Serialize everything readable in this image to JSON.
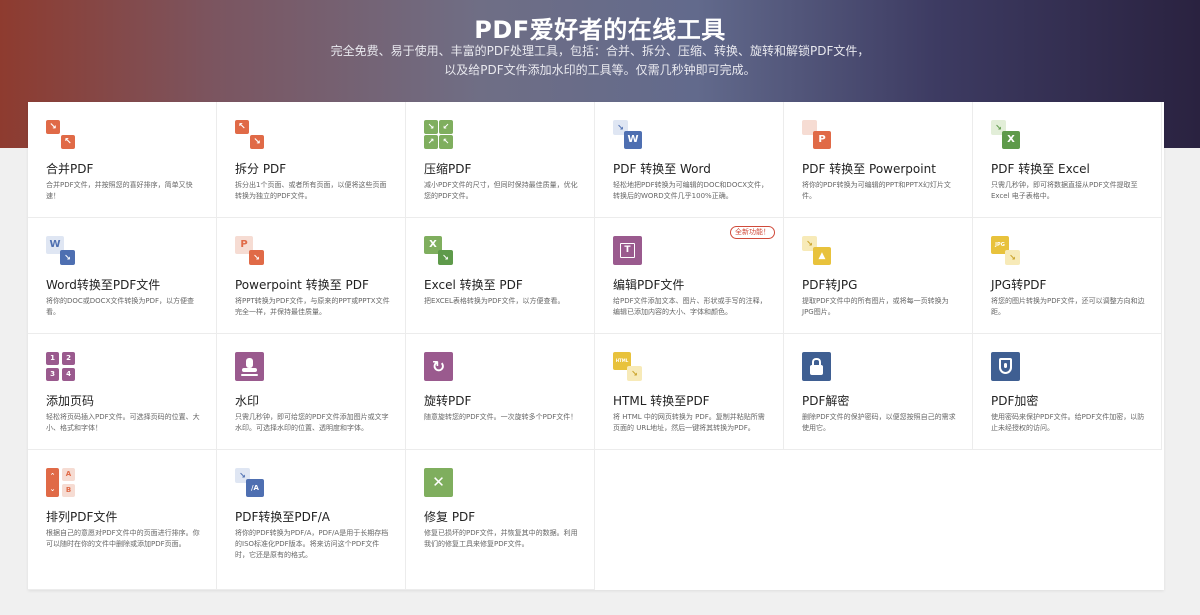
{
  "hero": {
    "title": "PDF爱好者的在线工具",
    "subtitle": "完全免费、易于使用、丰富的PDF处理工具，包括：合并、拆分、压缩、转换、旋转和解锁PDF文件，以及给PDF文件添加水印的工具等。仅需几秒钟即可完成。"
  },
  "colors": {
    "orange": "#e06a47",
    "green": "#7fae5e",
    "blue": "#4e6fb1",
    "purple": "#9a5a8e",
    "yellow": "#e8c23c",
    "navy": "#3f5f92"
  },
  "tools": [
    {
      "title": "合并PDF",
      "desc": "合并PDF文件，并按照您的喜好排序，简单又快速！",
      "icon": "merge-icon"
    },
    {
      "title": "拆分 PDF",
      "desc": "拆分出1个页面、或者所有页面，以便将这些页面转换为独立的PDF文件。",
      "icon": "split-icon"
    },
    {
      "title": "压缩PDF",
      "desc": "减小PDF文件的尺寸，但同时保持最佳质量，优化您的PDF文件。",
      "icon": "compress-icon"
    },
    {
      "title": "PDF 转换至 Word",
      "desc": "轻松地把PDF转换为可编辑的DOC和DOCX文件，转换后的WORD文件几乎100%正确。",
      "icon": "pdf-to-word-icon",
      "glyph": "W"
    },
    {
      "title": "PDF 转换至 Powerpoint",
      "desc": "将你的PDF转换为可编辑的PPT和PPTX幻灯片文件。",
      "icon": "pdf-to-ppt-icon",
      "glyph": "P"
    },
    {
      "title": "PDF 转换至 Excel",
      "desc": "只需几秒钟，即可将数据直接从PDF文件提取至Excel 电子表格中。",
      "icon": "pdf-to-excel-icon",
      "glyph": "X"
    },
    {
      "title": "Word转换至PDF文件",
      "desc": "将你的DOC或DOCX文件转换为PDF，以方便查看。",
      "icon": "word-to-pdf-icon",
      "glyph": "W"
    },
    {
      "title": "Powerpoint 转换至 PDF",
      "desc": "将PPT转换为PDF文件，与原来的PPT或PPTX文件完全一样，并保持最佳质量。",
      "icon": "ppt-to-pdf-icon",
      "glyph": "P"
    },
    {
      "title": "Excel 转换至 PDF",
      "desc": "把EXCEL表格转换为PDF文件，以方便查看。",
      "icon": "excel-to-pdf-icon",
      "glyph": "X"
    },
    {
      "title": "编辑PDF文件",
      "desc": "给PDF文件添加文本、图片、形状或手写的注释，编辑已添加内容的大小、字体和颜色。",
      "icon": "edit-pdf-icon",
      "badge": "全新功能！"
    },
    {
      "title": "PDF转JPG",
      "desc": "提取PDF文件中的所有图片，或将每一页转换为JPG图片。",
      "icon": "pdf-to-jpg-icon"
    },
    {
      "title": "JPG转PDF",
      "desc": "将您的图片转换为PDF文件，还可以调整方向和边距。",
      "icon": "jpg-to-pdf-icon",
      "glyph": "JPG"
    },
    {
      "title": "添加页码",
      "desc": "轻松将页码插入PDF文件。可选择页码的位置、大小、格式和字体！",
      "icon": "page-numbers-icon"
    },
    {
      "title": "水印",
      "desc": "只需几秒钟，即可给您的PDF文件添加图片或文字水印。可选择水印的位置、透明度和字体。",
      "icon": "watermark-icon"
    },
    {
      "title": "旋转PDF",
      "desc": "随意旋转您的PDF文件。一次旋转多个PDF文件！",
      "icon": "rotate-icon"
    },
    {
      "title": "HTML 转换至PDF",
      "desc": "将 HTML 中的网页转换为 PDF。复制并粘贴所需页面的 URL地址，然后一键将其转换为PDF。",
      "icon": "html-to-pdf-icon",
      "glyph": "HTML"
    },
    {
      "title": "PDF解密",
      "desc": "删除PDF文件的保护密码，以便您按照自己的需求使用它。",
      "icon": "unlock-icon"
    },
    {
      "title": "PDF加密",
      "desc": "使用密码来保护PDF文件。给PDF文件加密，以防止未经授权的访问。",
      "icon": "protect-icon"
    },
    {
      "title": "排列PDF文件",
      "desc": "根据自己的意愿对PDF文件中的页面进行排序。你可以随时在你的文件中删除或添加PDF页面。",
      "icon": "organize-icon"
    },
    {
      "title": "PDF转换至PDF/A",
      "desc": "将你的PDF转换为PDF/A，PDF/A是用于长期存档的ISO标准化PDF版本。将来访问这个PDF文件时，它还是原有的格式。",
      "icon": "pdfa-icon",
      "glyph": "/A"
    },
    {
      "title": "修复 PDF",
      "desc": "修复已损坏的PDF文件，并恢复其中的数据。利用我们的修复工具来修复PDF文件。",
      "icon": "repair-icon"
    }
  ]
}
